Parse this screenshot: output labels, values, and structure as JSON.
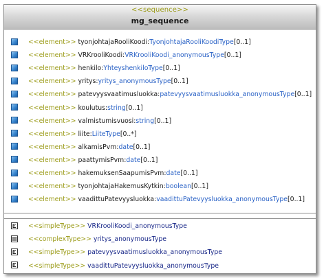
{
  "class": {
    "stereotype": "<<sequence>>",
    "name": "mg_sequence"
  },
  "attributes": [
    {
      "stereotype": "<<element>>",
      "name": "tyonjohtajaRooliKoodi",
      "sep": ":",
      "type": "TyonjohtajaRooliKoodiType",
      "mult": "[0..1]"
    },
    {
      "stereotype": "<<element>>",
      "name": "VRKrooliKoodi",
      "sep": ":",
      "type": "VRKrooliKoodi_anonymousType",
      "mult": "[0..1]"
    },
    {
      "stereotype": "<<element>>",
      "name": "henkilo",
      "sep": ":",
      "type": "YhteyshenkiloType",
      "mult": "[0..1]"
    },
    {
      "stereotype": "<<element>>",
      "name": "yritys",
      "sep": ":",
      "type": "yritys_anonymousType",
      "mult": "[0..1]"
    },
    {
      "stereotype": "<<element>>",
      "name": "patevyysvaatimusluokka",
      "sep": ":",
      "type": "patevyysvaatimusluokka_anonymousType",
      "mult": "[0..1]"
    },
    {
      "stereotype": "<<element>>",
      "name": "koulutus",
      "sep": ":",
      "type": "string",
      "mult": "[0..1]"
    },
    {
      "stereotype": "<<element>>",
      "name": "valmistumisvuosi",
      "sep": ":",
      "type": "string",
      "mult": "[0..1]"
    },
    {
      "stereotype": "<<element>>",
      "name": "liite",
      "sep": ":",
      "type": "LiiteType",
      "mult": "[0..*]"
    },
    {
      "stereotype": "<<element>>",
      "name": "alkamisPvm",
      "sep": ":",
      "type": "date",
      "mult": "[0..1]"
    },
    {
      "stereotype": "<<element>>",
      "name": "paattymisPvm",
      "sep": ":",
      "type": "date",
      "mult": "[0..1]"
    },
    {
      "stereotype": "<<element>>",
      "name": "hakemuksenSaapumisPvm",
      "sep": ":",
      "type": "date",
      "mult": "[0..1]"
    },
    {
      "stereotype": "<<element>>",
      "name": "tyonjohtajaHakemusKytkin",
      "sep": ":",
      "type": "boolean",
      "mult": "[0..1]"
    },
    {
      "stereotype": "<<element>>",
      "name": "vaadittuPatevyysluokka",
      "sep": ":",
      "type": "vaadittuPatevyysluokka_anonymousType",
      "mult": "[0..1]"
    }
  ],
  "nested_types": [
    {
      "kind": "simple",
      "icon": "simple-type-icon",
      "stereotype": "<<simpleType>>",
      "name": "VRKrooliKoodi_anonymousType"
    },
    {
      "kind": "complex",
      "icon": "complex-type-icon",
      "stereotype": "<<complexType>>",
      "name": "yritys_anonymousType"
    },
    {
      "kind": "simple",
      "icon": "simple-type-icon",
      "stereotype": "<<simpleType>>",
      "name": "patevyysvaatimusluokka_anonymousType"
    },
    {
      "kind": "simple",
      "icon": "simple-type-icon",
      "stereotype": "<<simpleType>>",
      "name": "vaadittuPatevyysluokka_anonymousType"
    }
  ],
  "colors": {
    "stereotype": "#9b9b18",
    "type": "#2a62c6",
    "nested_name": "#1b2a8a",
    "attribute_icon": "#3a87cf"
  }
}
